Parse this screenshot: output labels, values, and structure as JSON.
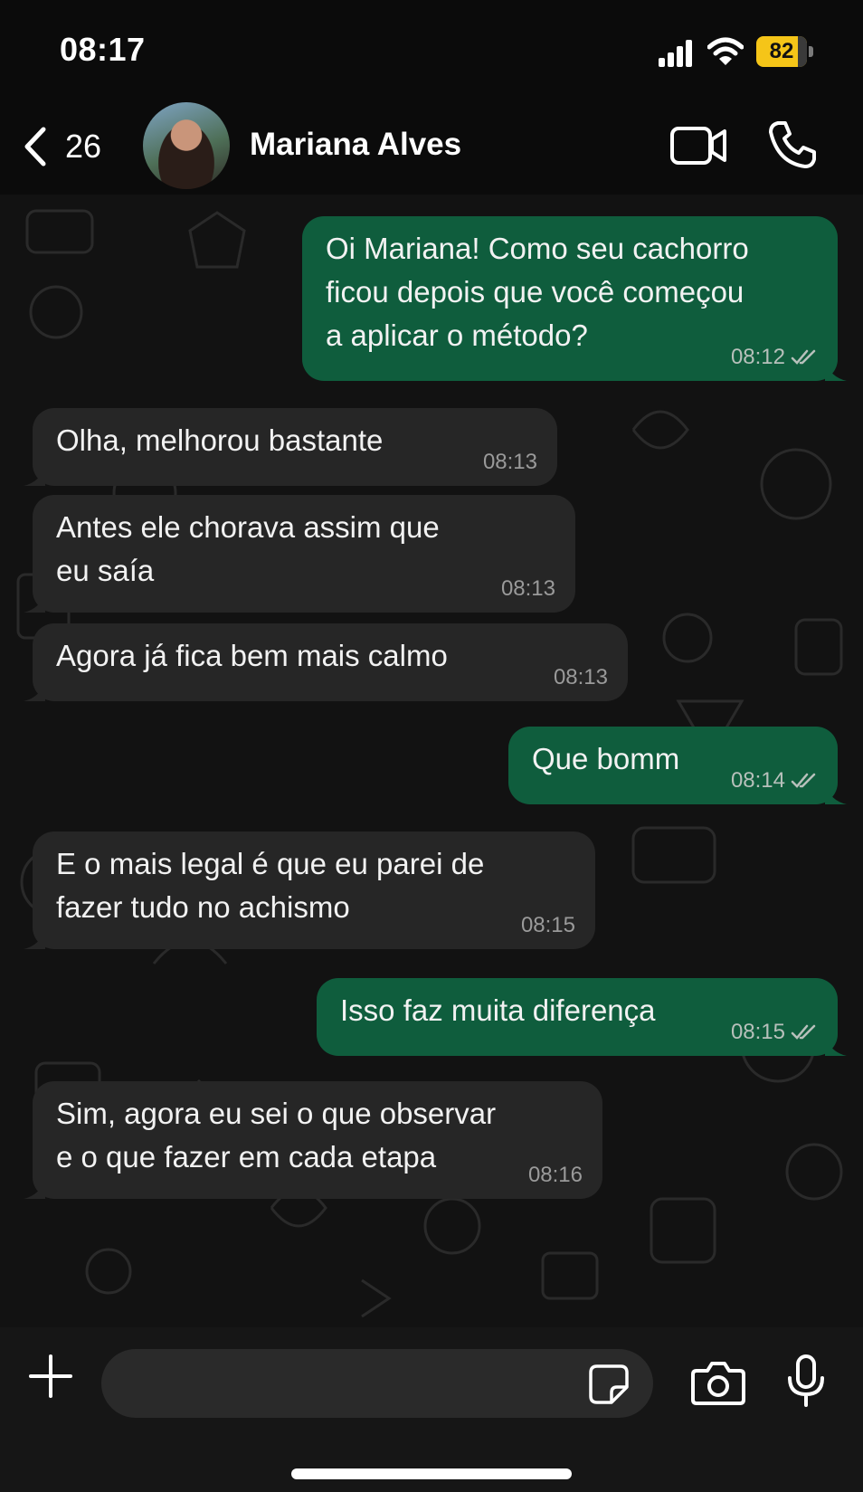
{
  "status_bar": {
    "time": "08:17",
    "battery_level": "82",
    "battery_fraction": 0.82
  },
  "header": {
    "back_count": "26",
    "contact_name": "Mariana Alves"
  },
  "messages": [
    {
      "direction": "out",
      "text": "Oi Mariana! Como seu cachorro\nficou depois que você começou\na aplicar o método?",
      "time": "08:12",
      "read": true
    },
    {
      "direction": "in",
      "text": "Olha, melhorou bastante",
      "time": "08:13"
    },
    {
      "direction": "in",
      "text": "Antes ele chorava assim que\neu saía",
      "time": "08:13"
    },
    {
      "direction": "in",
      "text": "Agora já fica bem mais calmo",
      "time": "08:13"
    },
    {
      "direction": "out",
      "text": "Que bomm",
      "time": "08:14",
      "read": true
    },
    {
      "direction": "in",
      "text": "E o mais legal é que eu parei de\nfazer tudo no achismo",
      "time": "08:15"
    },
    {
      "direction": "out",
      "text": "Isso faz muita diferença",
      "time": "08:15",
      "read": true
    },
    {
      "direction": "in",
      "text": "Sim, agora eu sei o que observar\ne o que fazer em cada etapa",
      "time": "08:16"
    }
  ],
  "composer": {
    "placeholder": ""
  },
  "colors": {
    "outgoing_bubble": "#0f5d3d",
    "incoming_bubble": "#262626",
    "read_ticks": "#b7c0bb",
    "battery": "#f5c518"
  },
  "icons": [
    "back-chevron-icon",
    "video-camera-icon",
    "phone-icon",
    "plus-icon",
    "sticker-icon",
    "camera-icon",
    "microphone-icon",
    "double-check-icon",
    "signal-icon",
    "wifi-icon",
    "battery-icon"
  ]
}
